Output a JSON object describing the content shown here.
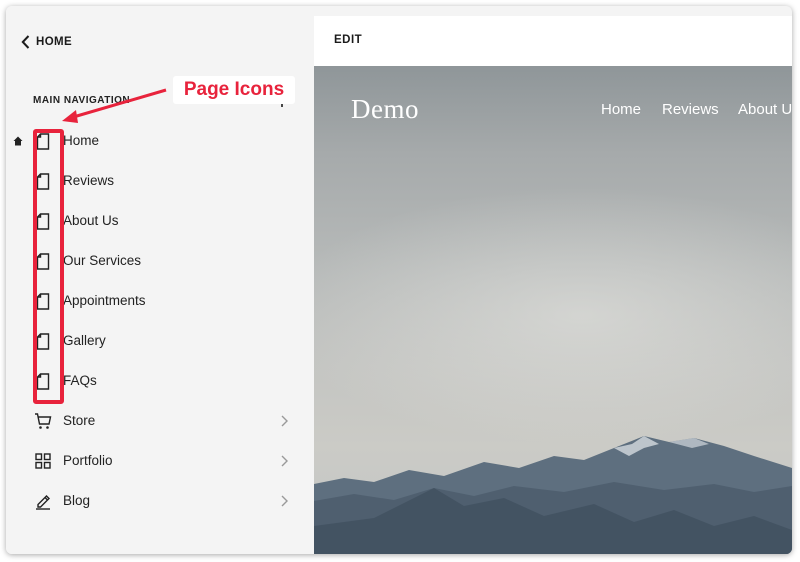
{
  "sidebar": {
    "back_label": "HOME",
    "section_title": "MAIN NAVIGATION",
    "pages": [
      {
        "label": "Home",
        "icon": "page-icon",
        "is_homepage": true
      },
      {
        "label": "Reviews",
        "icon": "page-icon"
      },
      {
        "label": "About Us",
        "icon": "page-icon"
      },
      {
        "label": "Our Services",
        "icon": "page-icon"
      },
      {
        "label": "Appointments",
        "icon": "page-icon"
      },
      {
        "label": "Gallery",
        "icon": "page-icon"
      },
      {
        "label": "FAQs",
        "icon": "page-icon"
      }
    ],
    "collections": [
      {
        "label": "Store",
        "icon": "cart-icon"
      },
      {
        "label": "Portfolio",
        "icon": "grid-icon"
      },
      {
        "label": "Blog",
        "icon": "pen-icon"
      }
    ]
  },
  "editbar": {
    "edit_label": "EDIT"
  },
  "preview": {
    "brand": "Demo",
    "nav_links": [
      "Home",
      "Reviews",
      "About Us"
    ]
  },
  "annotation": {
    "label": "Page Icons",
    "color": "#e8233c"
  }
}
